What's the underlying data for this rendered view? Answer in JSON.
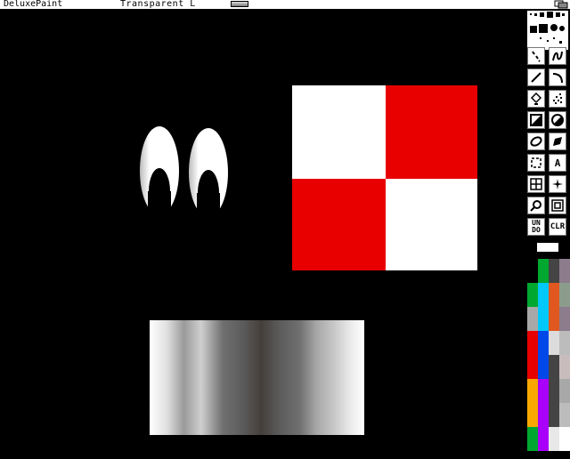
{
  "app": {
    "title": "DeluxePaint"
  },
  "status": {
    "mode_text": "Transparent L"
  },
  "tools": [
    {
      "name": "dotted-freehand-tool",
      "icon": "dotted-freehand-icon"
    },
    {
      "name": "continuous-freehand-tool",
      "icon": "continuous-freehand-icon"
    },
    {
      "name": "straight-line-tool",
      "icon": "straight-line-icon"
    },
    {
      "name": "curve-tool",
      "icon": "curve-icon"
    },
    {
      "name": "fill-tool",
      "icon": "fill-bucket-icon"
    },
    {
      "name": "airbrush-tool",
      "icon": "airbrush-icon"
    },
    {
      "name": "rectangle-tool",
      "icon": "rectangle-icon"
    },
    {
      "name": "circle-tool",
      "icon": "circle-icon"
    },
    {
      "name": "ellipse-tool",
      "icon": "ellipse-icon"
    },
    {
      "name": "polygon-tool",
      "icon": "polygon-icon"
    },
    {
      "name": "brush-select-tool",
      "icon": "brush-select-icon"
    },
    {
      "name": "text-tool",
      "label": "A",
      "icon": "text-icon"
    },
    {
      "name": "grid-tool",
      "icon": "grid-icon"
    },
    {
      "name": "symmetry-tool",
      "icon": "symmetry-icon"
    },
    {
      "name": "magnify-tool",
      "icon": "magnify-icon"
    },
    {
      "name": "zoom-tool",
      "icon": "zoom-icon"
    },
    {
      "name": "undo-button",
      "label": "UN DO",
      "icon": "undo-icon"
    },
    {
      "name": "clear-button",
      "label": "CLR",
      "icon": "clear-icon"
    }
  ],
  "palette": {
    "col1": [
      "#000000",
      "#00a830",
      "#a8a8a8",
      "#e80000",
      "#e80000",
      "#f8a800",
      "#f8a800",
      "#00a830"
    ],
    "col2": [
      "#00a830",
      "#00c8f8",
      "#00c8f8",
      "#0048e8",
      "#0048e8",
      "#a800f8",
      "#a800f8",
      "#a800f8"
    ],
    "col3": [
      "#444444",
      "#e05820",
      "#e05820",
      "#dcdcdc",
      "#444444",
      "#444444",
      "#444444",
      "#e8e8e8"
    ],
    "col4": [
      "#8c7c8c",
      "#8c9c8c",
      "#8c7c8c",
      "#bcbcbc",
      "#c8bcbc",
      "#a8a8a8",
      "#bcbcbc",
      "#ffffff"
    ]
  },
  "colors": {
    "fg": "#ffffff",
    "red": "#e80000",
    "white": "#ffffff"
  }
}
